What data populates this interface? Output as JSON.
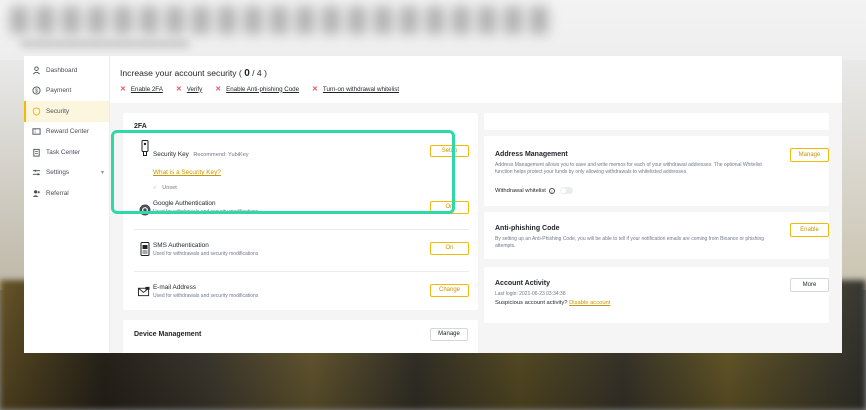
{
  "sidebar": {
    "items": [
      {
        "label": "Dashboard",
        "icon": "person-icon"
      },
      {
        "label": "Payment",
        "icon": "dollar-icon"
      },
      {
        "label": "Security",
        "icon": "shield-icon",
        "active": true
      },
      {
        "label": "Reward Center",
        "icon": "ticket-icon"
      },
      {
        "label": "Task Center",
        "icon": "clipboard-icon"
      },
      {
        "label": "Settings",
        "icon": "sliders-icon",
        "has_chevron": true
      },
      {
        "label": "Referral",
        "icon": "add-user-icon"
      }
    ]
  },
  "header": {
    "title_prefix": "Increase your account security (",
    "score": "0",
    "title_suffix": "/ 4 )",
    "requirements": [
      "Enable 2FA",
      "Verify",
      "Enable Anti-phishing Code",
      "Turn-on withdrawal whitelist"
    ]
  },
  "two_fa": {
    "heading": "2FA",
    "security_key": {
      "name": "Security Key",
      "recommend": "Recommend: YubiKey",
      "link": "What is a Security Key?",
      "status": "Unset",
      "button": "Setup"
    },
    "google": {
      "name": "Google Authentication",
      "desc": "Used for withdrawals and security modifications",
      "button": "On"
    },
    "sms": {
      "name": "SMS Authentication",
      "desc": "Used for withdrawals and security modifications",
      "button": "On"
    },
    "email": {
      "name": "E-mail Address",
      "desc": "Used for withdrawals and security modifications",
      "button": "Change"
    }
  },
  "device": {
    "title": "Device Management",
    "button": "Manage"
  },
  "address": {
    "title": "Address Management",
    "desc": "Address Management allows you to save and write memos for each of your withdrawal addresses. The optional Whitelist function helps protect your funds by only allowing withdrawals to whitelisted addresses.",
    "button": "Manage",
    "whitelist_label": "Withdrawal whitelist"
  },
  "antiphishing": {
    "title": "Anti-phishing Code",
    "desc": "By setting up an Anti-Phishing Code, you will be able to tell if your notification emails are coming from Binance or phishing attempts.",
    "button": "Enable"
  },
  "activity": {
    "title": "Account Activity",
    "last_login": "Last login: 2021-06-23 03:34:38",
    "suspicious": "Suspicious account activity?",
    "disable_link": "Disable account",
    "button": "More"
  },
  "colors": {
    "accent": "#f0b90b",
    "highlight": "#2fd8a8",
    "warning": "#f6465d"
  }
}
